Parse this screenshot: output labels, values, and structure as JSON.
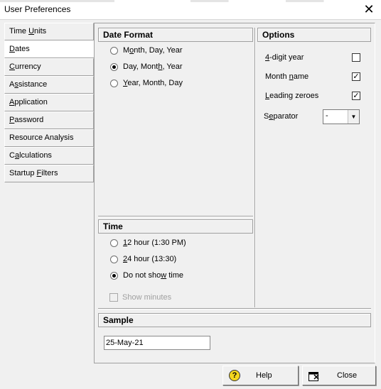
{
  "window": {
    "title": "User Preferences",
    "close_glyph": "✕"
  },
  "tabs": [
    {
      "label": "Time Units",
      "active": false
    },
    {
      "label": "Dates",
      "active": true
    },
    {
      "label": "Currency",
      "active": false
    },
    {
      "label": "Assistance",
      "active": false
    },
    {
      "label": "Application",
      "active": false
    },
    {
      "label": "Password",
      "active": false
    },
    {
      "label": "Resource Analysis",
      "active": false
    },
    {
      "label": "Calculations",
      "active": false
    },
    {
      "label": "Startup Filters",
      "active": false
    }
  ],
  "date_format": {
    "header": "Date Format",
    "options": [
      {
        "label": "Month, Day, Year",
        "selected": false
      },
      {
        "label": "Day, Month, Year",
        "selected": true
      },
      {
        "label": "Year, Month, Day",
        "selected": false
      }
    ]
  },
  "options": {
    "header": "Options",
    "four_digit_year": {
      "label": "4-digit year",
      "checked": false
    },
    "month_name": {
      "label": "Month name",
      "checked": true
    },
    "leading_zeroes": {
      "label": "Leading zeroes",
      "checked": true
    },
    "separator": {
      "label": "Separator",
      "value": "-"
    }
  },
  "time": {
    "header": "Time",
    "options": [
      {
        "label": "12 hour (1:30 PM)",
        "selected": false
      },
      {
        "label": "24 hour (13:30)",
        "selected": false
      },
      {
        "label": "Do not show time",
        "selected": true
      }
    ],
    "show_minutes": {
      "label": "Show minutes",
      "checked": false,
      "enabled": false
    }
  },
  "sample": {
    "header": "Sample",
    "value": "25-May-21"
  },
  "buttons": {
    "help": "Help",
    "close": "Close"
  }
}
